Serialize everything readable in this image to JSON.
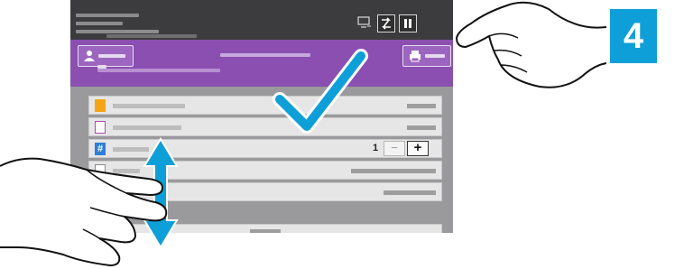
{
  "step_badge": {
    "label": "4",
    "color": "#0e9fd8"
  },
  "top_bar": {
    "icons": [
      "display-icon",
      "swap-icon",
      "pause-icon"
    ]
  },
  "app_bar": {
    "icons": [
      "user-icon",
      "printer-icon"
    ]
  },
  "options": [
    {
      "icon": "document-icon"
    },
    {
      "icon": "image-icon"
    },
    {
      "icon": "hash-icon",
      "quantity": "1",
      "stepper": {
        "minus": "−",
        "plus": "+"
      }
    },
    {
      "icon": "sheet-icon"
    },
    {}
  ],
  "overlay": {
    "checkmark": "checkmark-icon",
    "scroll_arrow": "double-arrow-icon"
  },
  "colors": {
    "app_bar": "#8a4fb0",
    "top_bar": "#3c3c3e",
    "accent": "#0e9fd8",
    "doc_icon": "#f6a416",
    "image_icon": "#b04bb0",
    "hash_icon": "#2e7fd6"
  }
}
